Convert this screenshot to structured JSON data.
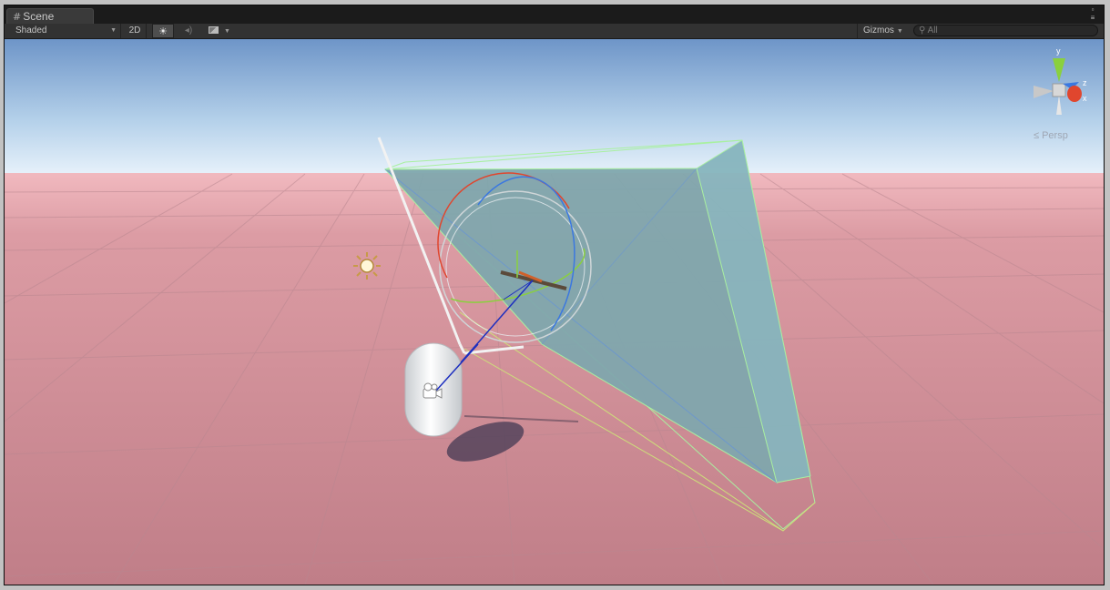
{
  "window": {
    "tab_label": "Scene",
    "tab_icon": "grid-hash-icon",
    "menu_icon": "window-menu-icon"
  },
  "toolbar": {
    "draw_mode": "Shaded",
    "mode_2d": "2D",
    "lighting_icon": "sun-icon",
    "audio_icon": "speaker-icon",
    "effects_icon": "image-icon",
    "gizmos_label": "Gizmos",
    "search_placeholder": "All"
  },
  "scene": {
    "orientation_axes": [
      "y",
      "z",
      "x"
    ],
    "projection_label": "Persp",
    "colors": {
      "sky_top": "#6e95c8",
      "sky_horizon": "#e4f0fa",
      "ground": "#c88690",
      "box": "#7fa7ad",
      "wire": "#a9f0a0",
      "capsule": "#e8eaec",
      "axis_x": "#e0462e",
      "axis_y": "#8ad03e",
      "axis_z": "#3b78e0"
    }
  }
}
